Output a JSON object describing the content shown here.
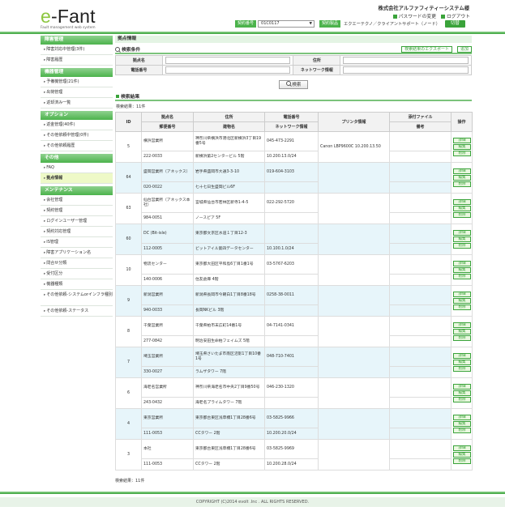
{
  "header": {
    "logo_prefix": "e",
    "logo_rest": "-Fant",
    "logo_sub": "Fault management web system",
    "company": "株式会社アルファフィティーシステム様",
    "password_change": "パスワードの変更",
    "logout": "ログアウト",
    "contract_label": "契約番号",
    "contract_value": "01C0117",
    "product_label": "契約製品",
    "product_value": "エクエーテクノ／クライアントサポート（ノード）",
    "switch_button": "切替"
  },
  "sidebar": [
    {
      "head": "障害管理",
      "items": [
        "障害対応中管理(3件)",
        "障害履歴"
      ]
    },
    {
      "head": "機器管理",
      "items": [
        "予備機管理(21件)",
        "出荷管理",
        "返却済み一覧"
      ]
    },
    {
      "head": "オプション",
      "items": [
        "返金管理(40件)",
        "その他依頼中管理(0件)",
        "その他依頼履歴"
      ]
    },
    {
      "head": "その他",
      "items": [
        "FAQ",
        "拠点情報"
      ]
    },
    {
      "head": "メンテナンス",
      "items": [
        "会社管理",
        "契約管理",
        "ログインユーザー管理",
        "契約対応管理",
        "IS管理",
        "障害アプリケーション名",
        "問合せ分類",
        "受付区分",
        "機器種類",
        "その他依頼-システムorインフラ種別",
        "その他依頼-ステータス"
      ]
    }
  ],
  "main": {
    "section_title": "拠点情報",
    "condition_title": "検索条件",
    "export_button": "検索結果のエクスポート",
    "add_button": "追加",
    "labels": {
      "name": "拠点名",
      "address": "住所",
      "phone": "電話番号",
      "network": "ネットワーク情報"
    },
    "search_button": "検索",
    "result_title": "検索結果",
    "result_count": "検索結果：11件"
  },
  "table": {
    "headers": {
      "id": "ID",
      "name": "拠点名",
      "postal": "郵便番号",
      "address": "住所",
      "building": "建物名",
      "phone": "電話番号",
      "network": "ネットワーク情報",
      "printer": "プリンタ情報",
      "attach": "添付ファイル",
      "remarks": "備考",
      "ops": "操作"
    },
    "ops": {
      "detail": "詳細",
      "edit": "編集",
      "delete": "削除"
    },
    "rows": [
      {
        "id": "5",
        "name": "横浜営業所",
        "postal": "222-0033",
        "address": "神奈川県横浜市港北区新横浜3丁目19番5号",
        "building": "新横浜第2センタービル 5階",
        "phone": "045-473-2291",
        "network": "10.200.13.0/24",
        "printer": "Canon LBP9600C 10.200.13.50"
      },
      {
        "id": "64",
        "name": "盛岡営業所（アネックス）",
        "postal": "020-0022",
        "address": "岩手県盛岡市大通3-3-10",
        "building": "七十七日生盛岡ビル6F",
        "phone": "019-604-3103",
        "network": "",
        "printer": ""
      },
      {
        "id": "63",
        "name": "仙台営業所（アネックス本社）",
        "postal": "984-0051",
        "address": "宮城県仙台市若林区新寺1-4-5",
        "building": "ノースピア 5F",
        "phone": "022-292-5720",
        "network": "",
        "printer": ""
      },
      {
        "id": "60",
        "name": "DC (Bit-isle)",
        "postal": "112-0005",
        "address": "東京都文京区水道１丁目12-3",
        "building": "ビットアイル第四データセンター",
        "phone": "",
        "network": "10.100.1.0/24",
        "printer": ""
      },
      {
        "id": "10",
        "name": "物流センター",
        "postal": "140-0006",
        "address": "東京都大田区平和島6丁目1番1号",
        "building": "住友倉庫 4階",
        "phone": "03-5767-6203",
        "network": "",
        "printer": ""
      },
      {
        "id": "9",
        "name": "新潟営業所",
        "postal": "940-0033",
        "address": "新潟県長岡市今朝白1丁目8番18号",
        "building": "長岡NKビル 3階",
        "phone": "0258-38-0011",
        "network": "",
        "printer": ""
      },
      {
        "id": "8",
        "name": "千葉営業所",
        "postal": "277-0842",
        "address": "千葉県柏市末広町14番1号",
        "building": "明治安田生命柏フェイムズ 5階",
        "phone": "04-7141-0341",
        "network": "",
        "printer": ""
      },
      {
        "id": "7",
        "name": "埼玉営業所",
        "postal": "330-0027",
        "address": "埼玉県さいたま市南区沼影1丁目10番1号",
        "building": "ラムザタワー 7階",
        "phone": "048-710-7401",
        "network": "",
        "printer": ""
      },
      {
        "id": "6",
        "name": "海老名営業所",
        "postal": "243-0432",
        "address": "神奈川県海老名市中央2丁目9番50号",
        "building": "海老名プライムタワー 7階",
        "phone": "046-230-1320",
        "network": "",
        "printer": ""
      },
      {
        "id": "4",
        "name": "東京営業所",
        "postal": "111-0053",
        "address": "東京都台東区浅草橋1丁目28番6号",
        "building": "CCタワー 2階",
        "phone": "03-5825-9966",
        "network": "10.200.20.0/24",
        "printer": ""
      },
      {
        "id": "3",
        "name": "本社",
        "postal": "111-0053",
        "address": "東京都台東区浅草橋1丁目28番6号",
        "building": "CCタワー 2階",
        "phone": "03-5825-9969",
        "network": "10.200.28.0/24",
        "printer": ""
      }
    ]
  },
  "footer": {
    "count": "検索結果：11件",
    "copyright": "COPYRIGHT (C)2014 evolt .Inc . ALL RIGHTS RESERVED."
  }
}
